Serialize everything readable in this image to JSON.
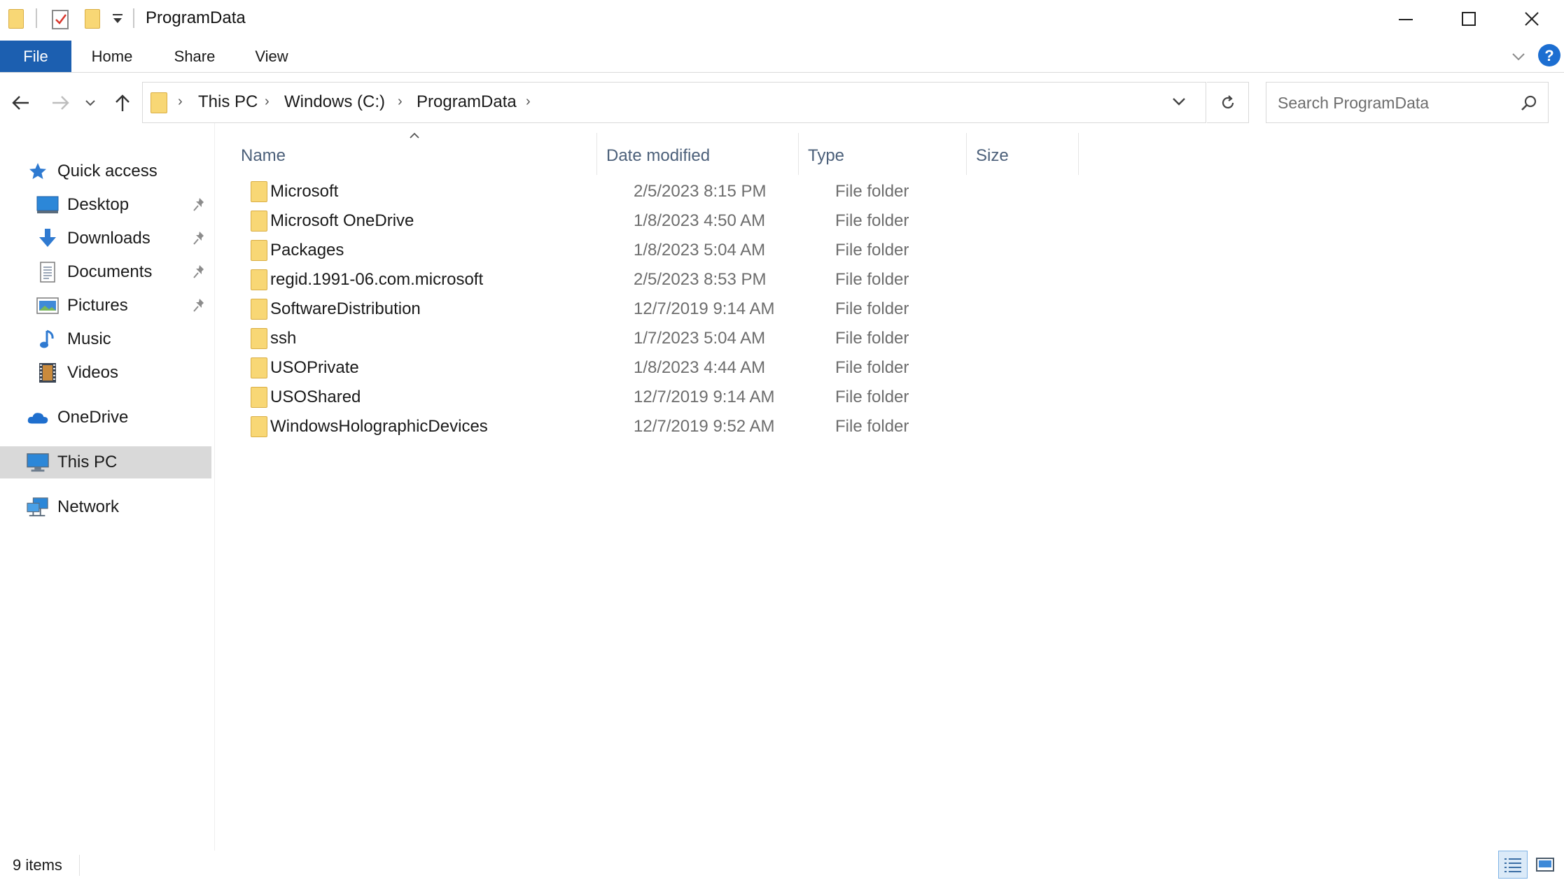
{
  "window": {
    "title": "ProgramData"
  },
  "ribbon": {
    "tabs": [
      {
        "label": "File"
      },
      {
        "label": "Home"
      },
      {
        "label": "Share"
      },
      {
        "label": "View"
      }
    ]
  },
  "address": {
    "crumbs": [
      "This PC",
      "Windows (C:)",
      "ProgramData"
    ],
    "search_placeholder": "Search ProgramData"
  },
  "nav": {
    "quick_access": "Quick access",
    "pinned": [
      {
        "label": "Desktop"
      },
      {
        "label": "Downloads"
      },
      {
        "label": "Documents"
      },
      {
        "label": "Pictures"
      }
    ],
    "libraries": [
      {
        "label": "Music"
      },
      {
        "label": "Videos"
      }
    ],
    "onedrive": "OneDrive",
    "this_pc": "This PC",
    "network": "Network"
  },
  "files": {
    "columns": [
      "Name",
      "Date modified",
      "Type",
      "Size"
    ],
    "rows": [
      {
        "name": "Microsoft",
        "date": "2/5/2023 8:15 PM",
        "type": "File folder"
      },
      {
        "name": "Microsoft OneDrive",
        "date": "1/8/2023 4:50 AM",
        "type": "File folder"
      },
      {
        "name": "Packages",
        "date": "1/8/2023 5:04 AM",
        "type": "File folder"
      },
      {
        "name": "regid.1991-06.com.microsoft",
        "date": "2/5/2023 8:53 PM",
        "type": "File folder"
      },
      {
        "name": "SoftwareDistribution",
        "date": "12/7/2019 9:14 AM",
        "type": "File folder"
      },
      {
        "name": "ssh",
        "date": "1/7/2023 5:04 AM",
        "type": "File folder"
      },
      {
        "name": "USOPrivate",
        "date": "1/8/2023 4:44 AM",
        "type": "File folder"
      },
      {
        "name": "USOShared",
        "date": "12/7/2019 9:14 AM",
        "type": "File folder"
      },
      {
        "name": "WindowsHolographicDevices",
        "date": "12/7/2019 9:52 AM",
        "type": "File folder"
      }
    ]
  },
  "status": {
    "item_count": "9 items"
  },
  "colors": {
    "accent": "#1c5fb0",
    "folder": "#f8d775",
    "selected_nav": "#d9d9d9",
    "column_header": "#4c607a"
  }
}
